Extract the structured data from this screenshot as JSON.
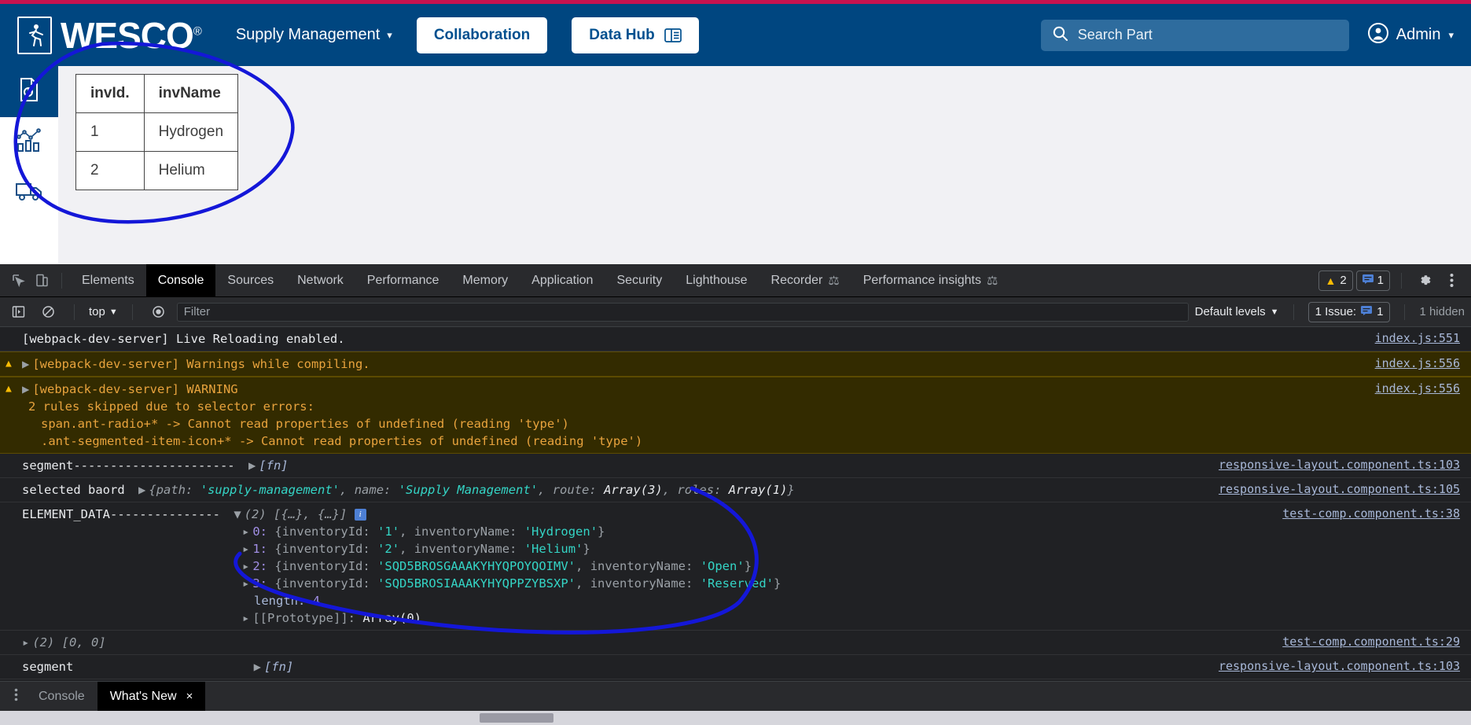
{
  "webapp": {
    "brand": {
      "name": "WESCO",
      "registered": "®",
      "logo_icon": "wesco-runner-logo-icon"
    },
    "nav": {
      "dropdown_label": "Supply Management",
      "buttons": [
        {
          "label": "Collaboration",
          "icon": null
        },
        {
          "label": "Data Hub",
          "icon": "data-hub-icon"
        }
      ]
    },
    "search": {
      "placeholder": "Search Part",
      "icon": "search-icon"
    },
    "user": {
      "label": "Admin",
      "icon": "account-circle-icon",
      "chevron": "chevron-down-icon"
    },
    "rail": [
      {
        "name": "report-document-icon",
        "active": true
      },
      {
        "name": "analytics-chart-icon",
        "active": false
      },
      {
        "name": "delivery-truck-icon",
        "active": false
      }
    ],
    "table": {
      "headers": [
        "invId.",
        "invName"
      ],
      "rows": [
        [
          "1",
          "Hydrogen"
        ],
        [
          "2",
          "Helium"
        ]
      ]
    },
    "colors": {
      "accent_bar": "#c8134f",
      "header_bg": "#004680",
      "button_text": "#00508f"
    }
  },
  "devtools": {
    "toolbar": {
      "inspect_icon": "inspect-element-icon",
      "device_icon": "device-toolbar-icon",
      "tabs": [
        {
          "label": "Elements",
          "active": false,
          "flask": false
        },
        {
          "label": "Console",
          "active": true,
          "flask": false
        },
        {
          "label": "Sources",
          "active": false,
          "flask": false
        },
        {
          "label": "Network",
          "active": false,
          "flask": false
        },
        {
          "label": "Performance",
          "active": false,
          "flask": false
        },
        {
          "label": "Memory",
          "active": false,
          "flask": false
        },
        {
          "label": "Application",
          "active": false,
          "flask": false
        },
        {
          "label": "Security",
          "active": false,
          "flask": false
        },
        {
          "label": "Lighthouse",
          "active": false,
          "flask": false
        },
        {
          "label": "Recorder",
          "active": false,
          "flask": true
        },
        {
          "label": "Performance insights",
          "active": false,
          "flask": true
        }
      ],
      "warning_count": "2",
      "message_count": "1",
      "settings_icon": "gear-icon",
      "more_icon": "more-vertical-icon"
    },
    "filterbar": {
      "sidebar_icon": "console-sidebar-icon",
      "clear_icon": "clear-console-icon",
      "context": "top",
      "eye_icon": "live-expression-icon",
      "filter_placeholder": "Filter",
      "levels": "Default levels",
      "issues": "1 Issue:",
      "issues_count": "1",
      "hidden": "1 hidden"
    },
    "console_rows": [
      {
        "type": "info",
        "text": "[webpack-dev-server] Live Reloading enabled.",
        "source": "index.js:551"
      },
      {
        "type": "warning",
        "text": "[webpack-dev-server] Warnings while compiling.",
        "source": "index.js:556"
      },
      {
        "type": "warning",
        "text": "[webpack-dev-server] WARNING",
        "extra_lines": [
          "2 rules skipped due to selector errors:",
          "span.ant-radio+* -> Cannot read properties of undefined (reading 'type')",
          ".ant-segmented-item-icon+* -> Cannot read properties of undefined (reading 'type')"
        ],
        "source": "index.js:556"
      },
      {
        "type": "log-fn",
        "label": "segment----------------------",
        "value": "[fn]",
        "source": "responsive-layout.component.ts:103"
      },
      {
        "type": "log-object",
        "label": "selected baord",
        "source": "responsive-layout.component.ts:105",
        "object": {
          "path_key": "path:",
          "path_value": "'supply-management'",
          "name_key": "name:",
          "name_value": "'Supply Management'",
          "route_key": "route:",
          "route_value": "Array(3)",
          "roles_key": "roles:",
          "roles_value": "Array(1)"
        }
      },
      {
        "type": "log-array",
        "label": "ELEMENT_DATA---------------",
        "summary": "(2) [{…}, {…}]",
        "source": "test-comp.component.ts:38",
        "entries": [
          {
            "index": "0:",
            "id_key": "inventoryId:",
            "id_val": "'1'",
            "name_key": "inventoryName:",
            "name_val": "'Hydrogen'"
          },
          {
            "index": "1:",
            "id_key": "inventoryId:",
            "id_val": "'2'",
            "name_key": "inventoryName:",
            "name_val": "'Helium'"
          },
          {
            "index": "2:",
            "id_key": "inventoryId:",
            "id_val": "'SQD5BROSGAAAKYHYQPOYQOIMV'",
            "name_key": "inventoryName:",
            "name_val": "'Open'"
          },
          {
            "index": "3:",
            "id_key": "inventoryId:",
            "id_val": "'SQD5BROSIAAAKYHYQPPZYBSXP'",
            "name_key": "inventoryName:",
            "name_val": "'Reserved'"
          }
        ],
        "length_key": "length:",
        "length_val": "4",
        "prototype_key": "[[Prototype]]:",
        "prototype_val": "Array(0)"
      },
      {
        "type": "log-plain",
        "text": "(2) [0, 0]",
        "source": "test-comp.component.ts:29"
      },
      {
        "type": "log-fn",
        "label": "segment",
        "value": "[fn]",
        "source": "responsive-layout.component.ts:103"
      }
    ],
    "drawer": {
      "more_icon": "more-vertical-icon",
      "tabs": [
        {
          "label": "Console",
          "active": false,
          "closable": false
        },
        {
          "label": "What's New",
          "active": true,
          "closable": true,
          "close": "×"
        }
      ]
    }
  }
}
